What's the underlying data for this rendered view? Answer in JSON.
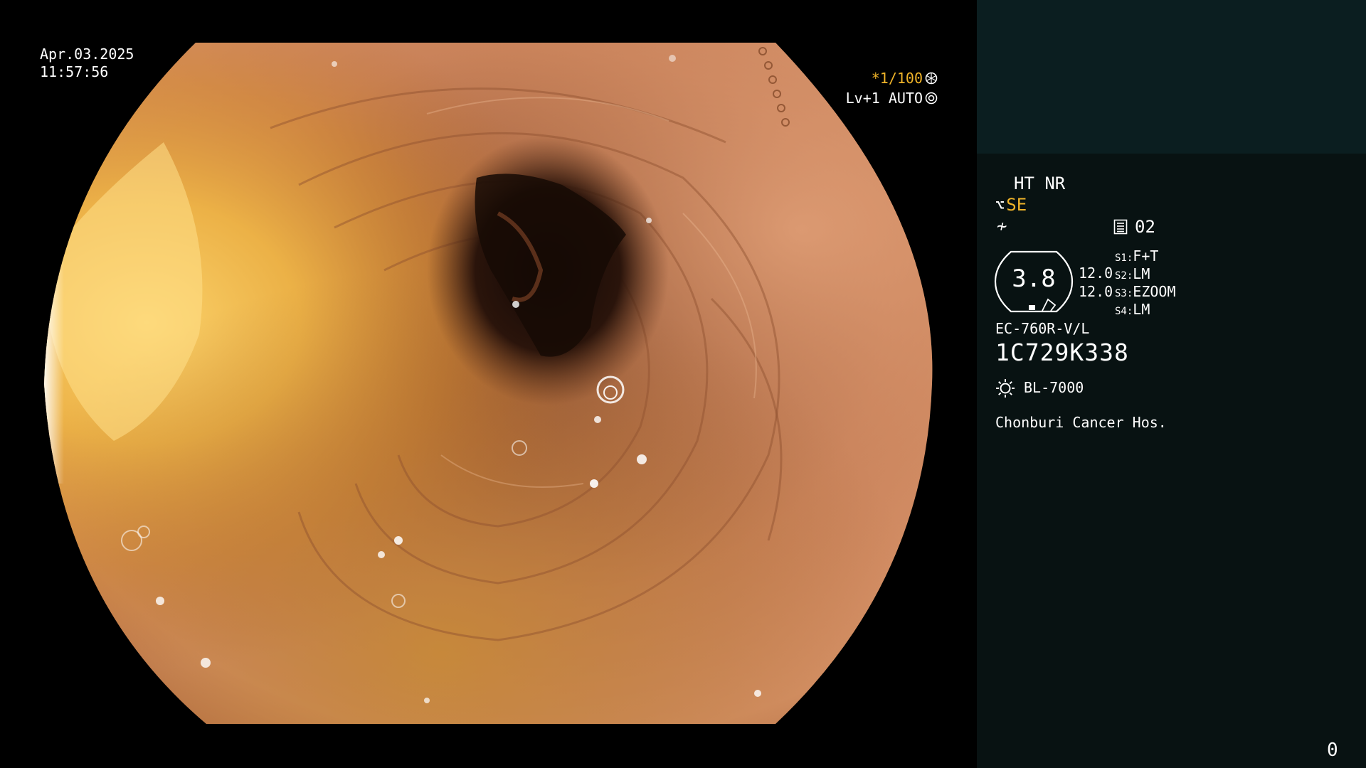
{
  "viewport": {
    "date": "Apr.03.2025",
    "time": "11:57:56",
    "shutter_value": "*1/100",
    "shutter_icon": "shutter-icon",
    "level_value": "Lv+1 AUTO",
    "level_icon": "iris-icon"
  },
  "panel": {
    "ht_nr": "HT NR",
    "se_label": "SE",
    "se_icon": "enhancement-icon",
    "nf_icon": "noise-filter-icon",
    "zoom_icon": "zoom-memory-icon",
    "zoom_count": "02",
    "scope_diameter": "3.8",
    "channels": [
      "12.0",
      "12.0"
    ],
    "switches": [
      {
        "key": "S1:",
        "value": "F+T"
      },
      {
        "key": "S2:",
        "value": "LM"
      },
      {
        "key": "S3:",
        "value": "EZOOM"
      },
      {
        "key": "S4:",
        "value": "LM"
      }
    ],
    "scope_model": "EC-760R-V/L",
    "scope_serial": "1C729K338",
    "light_icon": "light-source-icon",
    "light_source": "BL-7000",
    "hospital": "Chonburi Cancer Hos.",
    "frame_counter": "0"
  },
  "colors": {
    "panel_background": "#081212",
    "panel_top": "#0b1e20",
    "accent_yellow": "#f0b429",
    "mucosa_light": "#e2a173",
    "mucosa_dark": "#6b3a22",
    "bile_yellow": "#e9a93a"
  }
}
